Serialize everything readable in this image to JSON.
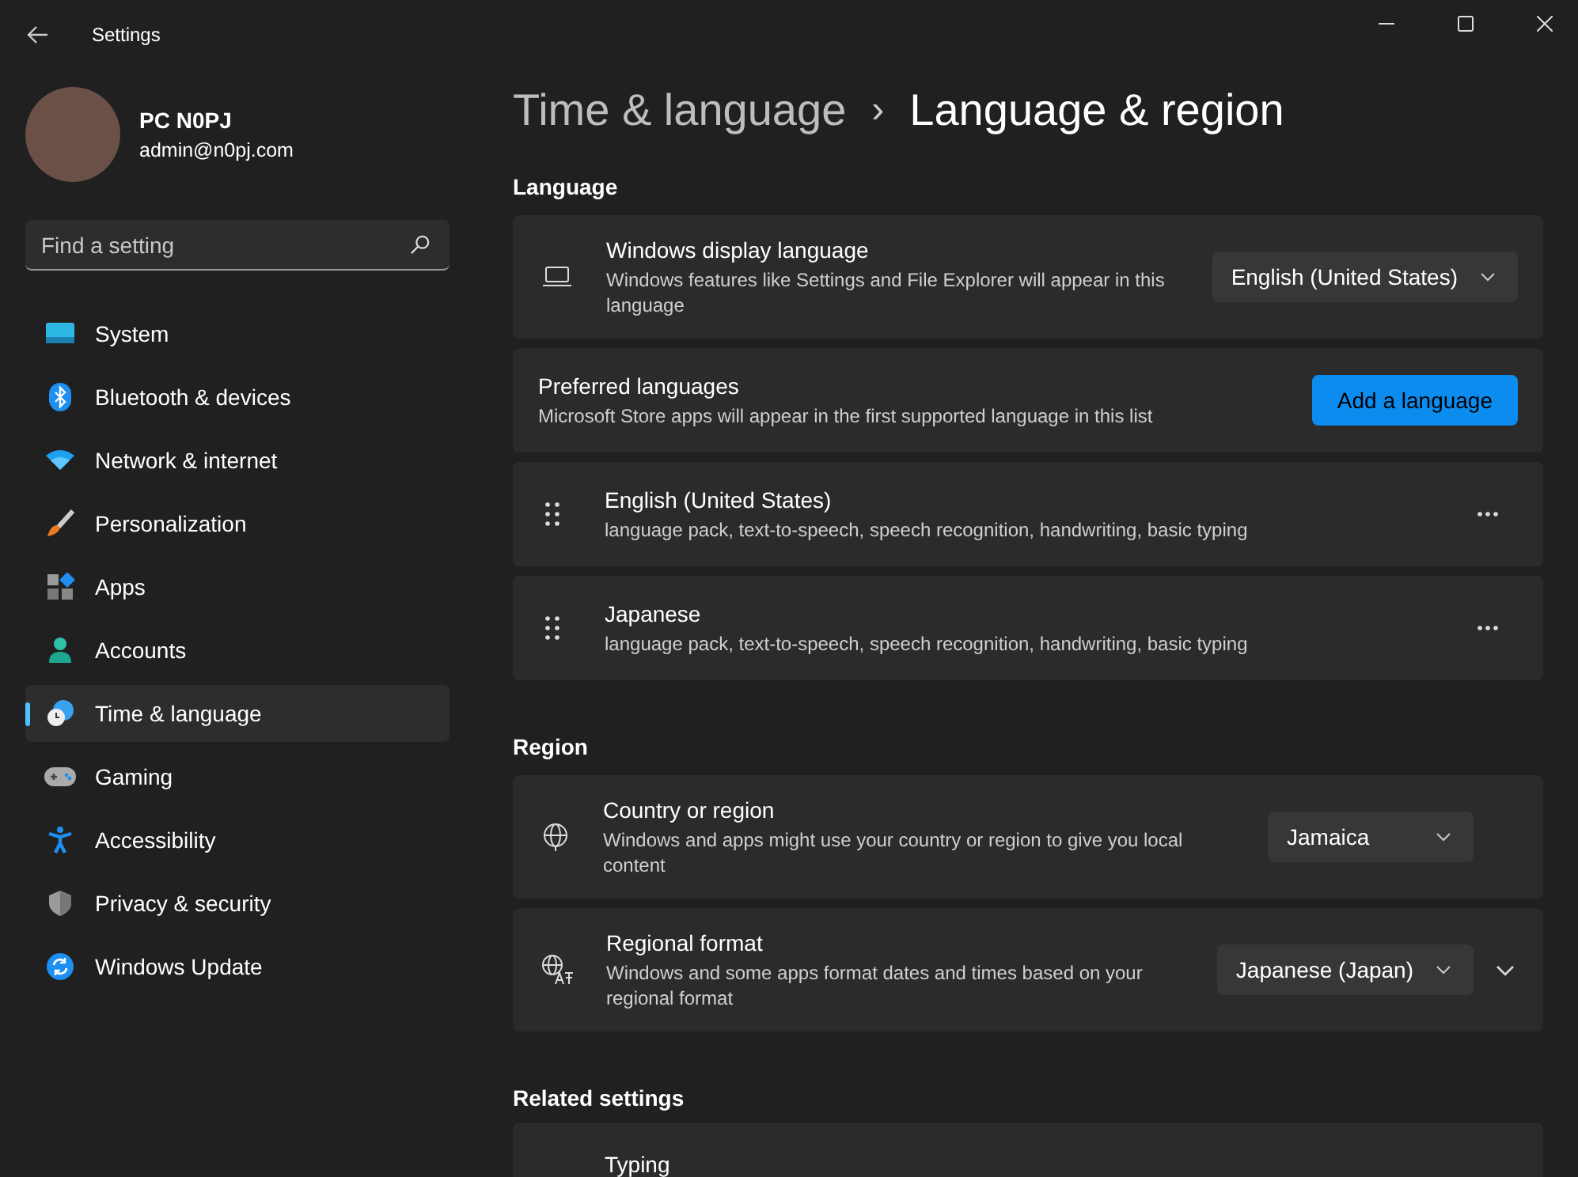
{
  "window": {
    "title": "Settings"
  },
  "user": {
    "name": "PC N0PJ",
    "email": "admin@n0pj.com"
  },
  "search": {
    "placeholder": "Find a setting"
  },
  "sidebar": {
    "items": [
      {
        "label": "System",
        "selected": false
      },
      {
        "label": "Bluetooth & devices",
        "selected": false
      },
      {
        "label": "Network & internet",
        "selected": false
      },
      {
        "label": "Personalization",
        "selected": false
      },
      {
        "label": "Apps",
        "selected": false
      },
      {
        "label": "Accounts",
        "selected": false
      },
      {
        "label": "Time & language",
        "selected": true
      },
      {
        "label": "Gaming",
        "selected": false
      },
      {
        "label": "Accessibility",
        "selected": false
      },
      {
        "label": "Privacy & security",
        "selected": false
      },
      {
        "label": "Windows Update",
        "selected": false
      }
    ]
  },
  "breadcrumb": {
    "parent": "Time & language",
    "separator": "›",
    "current": "Language & region"
  },
  "language": {
    "heading": "Language",
    "display_language": {
      "title": "Windows display language",
      "description": "Windows features like Settings and File Explorer will appear in this language",
      "value": "English (United States)"
    },
    "preferred": {
      "title": "Preferred languages",
      "description": "Microsoft Store apps will appear in the first supported language in this list",
      "button": "Add a language"
    },
    "languages": [
      {
        "name": "English (United States)",
        "features": "language pack, text-to-speech, speech recognition, handwriting, basic typing"
      },
      {
        "name": "Japanese",
        "features": "language pack, text-to-speech, speech recognition, handwriting, basic typing"
      }
    ]
  },
  "region": {
    "heading": "Region",
    "country": {
      "title": "Country or region",
      "description": "Windows and apps might use your country or region to give you local content",
      "value": "Jamaica"
    },
    "format": {
      "title": "Regional format",
      "description": "Windows and some apps format dates and times based on your regional format",
      "value": "Japanese (Japan)",
      "expanded": false
    }
  },
  "related": {
    "heading": "Related settings",
    "items": [
      {
        "title": "Typing"
      }
    ]
  }
}
